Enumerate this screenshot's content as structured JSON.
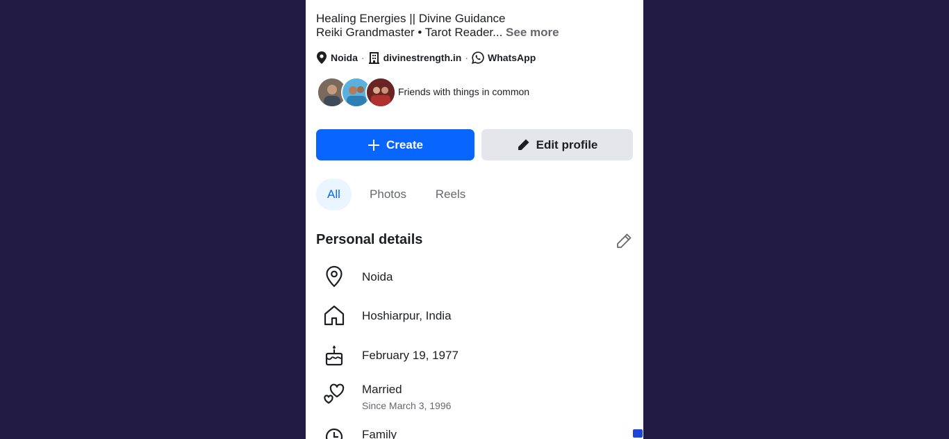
{
  "profile": {
    "bio_line1": "Healing Energies || Divine Guidance",
    "bio_line2": "Reiki Grandmaster • Tarot Reader...",
    "see_more": "See more"
  },
  "meta": {
    "location": "Noida",
    "website": "divinestrength.in",
    "whatsapp": "WhatsApp",
    "separator": "·"
  },
  "friends": {
    "text": "Friends with things in common",
    "avatars": [
      "friend-avatar-1",
      "friend-avatar-2",
      "friend-avatar-3"
    ]
  },
  "actions": {
    "create_label": "Create",
    "edit_label": "Edit profile",
    "create_color": "#0866ff",
    "edit_color": "#e4e6eb"
  },
  "tabs": [
    {
      "label": "All",
      "active": true
    },
    {
      "label": "Photos",
      "active": false
    },
    {
      "label": "Reels",
      "active": false
    }
  ],
  "personal_details": {
    "title": "Personal details",
    "items": [
      {
        "icon": "location-pin-icon",
        "text": "Noida"
      },
      {
        "icon": "home-icon",
        "text": "Hoshiarpur, India"
      },
      {
        "icon": "birthday-cake-icon",
        "text": "February 19, 1977"
      },
      {
        "icon": "hearts-icon",
        "text": "Married",
        "sub": "Since March 3, 1996"
      },
      {
        "icon": "family-icon",
        "text": "Family"
      }
    ]
  },
  "colors": {
    "background": "#211a42",
    "accent": "#0866ff",
    "active_tab_bg": "#ebf5ff",
    "secondary_text": "#65676b"
  }
}
